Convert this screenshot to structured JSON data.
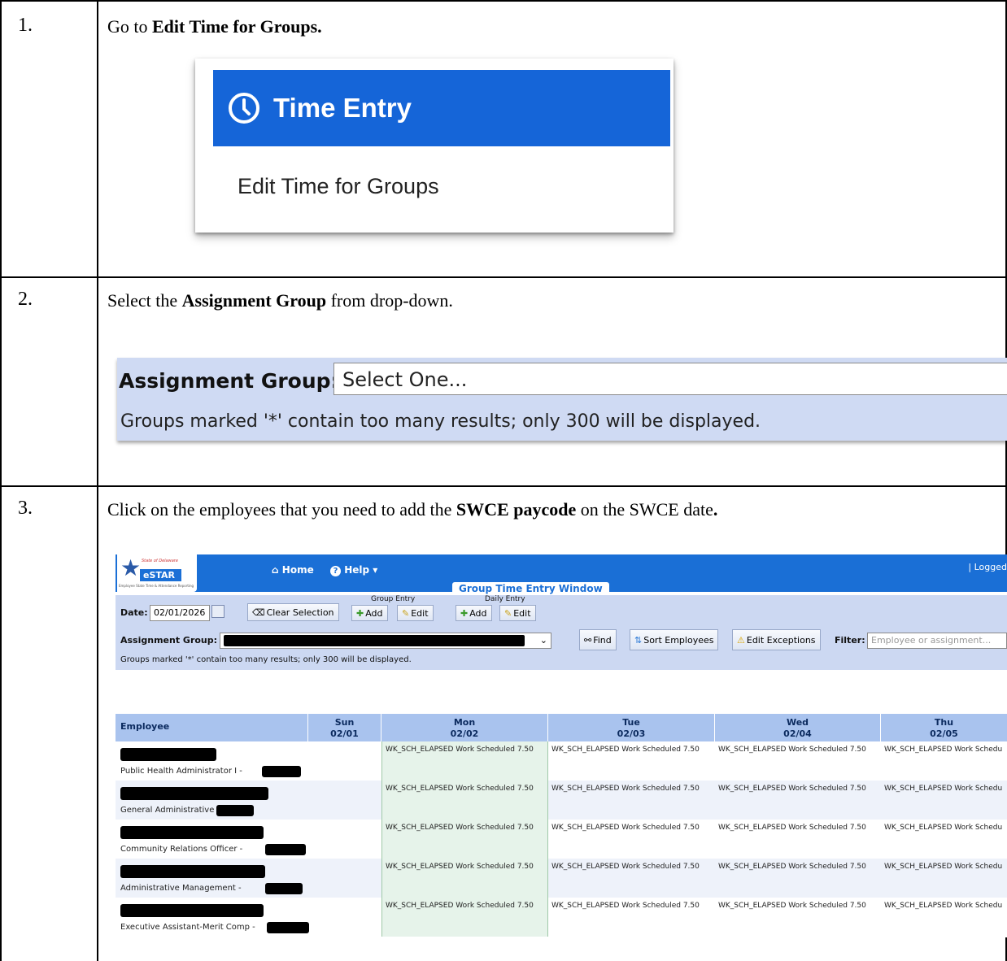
{
  "steps": [
    {
      "number": "1.",
      "text_pre": "Go to ",
      "text_bold": "Edit Time for Groups."
    },
    {
      "number": "2.",
      "text_pre": "Select the ",
      "text_bold": "Assignment Group",
      "text_post": " from drop-down."
    },
    {
      "number": "3.",
      "text_pre": "Click on the employees that you need to add the ",
      "text_bold": "SWCE paycode",
      "text_post": " on the SWCE date",
      "text_end": "."
    }
  ],
  "time_entry": {
    "title": "Time Entry",
    "link": "Edit Time for Groups",
    "header_color": "#1565d8"
  },
  "assignment_box": {
    "label": "Assignment Group:",
    "select_value": "Select One...",
    "note": "Groups marked '*' contain too many results; only 300 will be displayed."
  },
  "estar": {
    "logo_small": "State of Delaware",
    "logo_text": "eSTAR",
    "logo_tagline": "Employee State Time & Attendance Reporting",
    "nav_home": "Home",
    "nav_help": "Help",
    "logged": "| Logged",
    "window_title": "Group Time Entry Window",
    "date_label": "Date:",
    "date_value": "02/01/2026",
    "clear_selection": "Clear Selection",
    "group_entry": "Group Entry",
    "daily_entry": "Daily Entry",
    "add": "Add",
    "edit": "Edit",
    "assignment_label": "Assignment Group:",
    "find": "Find",
    "sort": "Sort Employees",
    "edit_exceptions": "Edit Exceptions",
    "filter_label": "Filter:",
    "filter_placeholder": "Employee or assignment...",
    "note": "Groups marked '*' contain too many results; only 300 will be displayed.",
    "columns": [
      {
        "day": "Employee",
        "date": ""
      },
      {
        "day": "Sun",
        "date": "02/01"
      },
      {
        "day": "Mon",
        "date": "02/02"
      },
      {
        "day": "Tue",
        "date": "02/03"
      },
      {
        "day": "Wed",
        "date": "02/04"
      },
      {
        "day": "Thu",
        "date": "02/05"
      }
    ],
    "entry": "WK_SCH_ELAPSED Work Scheduled  7.50",
    "entry_cut": "WK_SCH_ELAPSED Work Schedu",
    "employees": [
      {
        "title": "Public Health Administrator I -"
      },
      {
        "title": "General Administrative -"
      },
      {
        "title": "Community Relations Officer -"
      },
      {
        "title": "Administrative Management -"
      },
      {
        "title": "Executive Assistant-Merit Comp -"
      }
    ]
  }
}
